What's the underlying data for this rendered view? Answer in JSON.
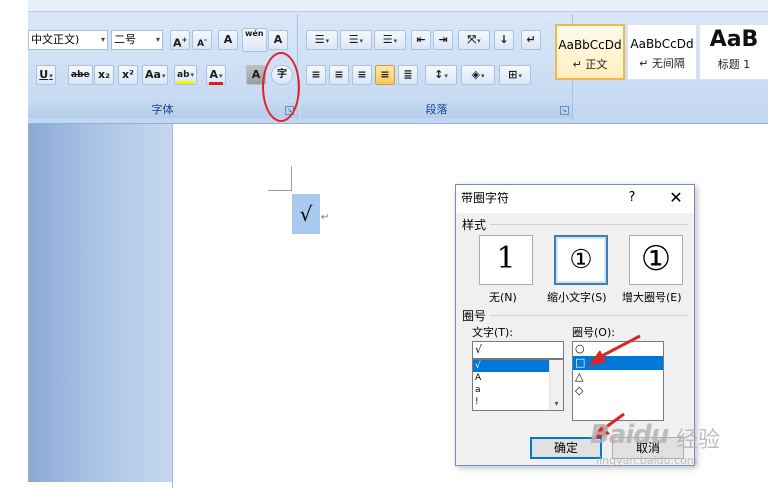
{
  "ribbon": {
    "font_group": {
      "label": "字体",
      "font_name": "中文正文)",
      "font_size": "二号",
      "buttons": {
        "grow": "A",
        "grow_sup": "+",
        "shrink": "A",
        "shrink_sup": "-",
        "clear_format": "A",
        "phonetic": "wén",
        "char_border": "A",
        "underline": "U",
        "strikethrough": "abe",
        "subscript": "x₂",
        "superscript": "x²",
        "change_case": "Aa",
        "highlight": "ab",
        "font_color": "A",
        "char_shading": "A",
        "enclose_char": "字"
      }
    },
    "paragraph_group": {
      "label": "段落"
    },
    "styles_group": {
      "cards": [
        {
          "sample": "AaBbCcDd",
          "name": "↵ 正文"
        },
        {
          "sample": "AaBbCcDd",
          "name": "↵ 无间隔"
        },
        {
          "sample": "AaB",
          "name": "标题 1"
        }
      ]
    }
  },
  "document": {
    "selected_char": "√",
    "paragraph_mark": "↵"
  },
  "dialog": {
    "title": "带圈字符",
    "help": "?",
    "close": "✕",
    "style_section": "样式",
    "style_options": [
      {
        "glyph": "1",
        "label": "无(N)"
      },
      {
        "glyph": "①",
        "label": "缩小文字(S)"
      },
      {
        "glyph": "①",
        "label": "增大圈号(E)"
      }
    ],
    "enclosure_section": "圈号",
    "text_label": "文字(T):",
    "text_value": "√",
    "text_list": [
      "√",
      "A",
      "a",
      "!"
    ],
    "circle_label": "圈号(O):",
    "circle_list": [
      "○",
      "□",
      "△",
      "◇"
    ],
    "ok": "确定",
    "cancel": "取消"
  },
  "watermark": {
    "logo": "Baidu",
    "cn": "经验",
    "url": "jingyan.baidu.com"
  },
  "colors": {
    "annotation_red": "#e02424",
    "selection_blue": "#0078d7",
    "ribbon_blue": "#cfe0f5"
  }
}
